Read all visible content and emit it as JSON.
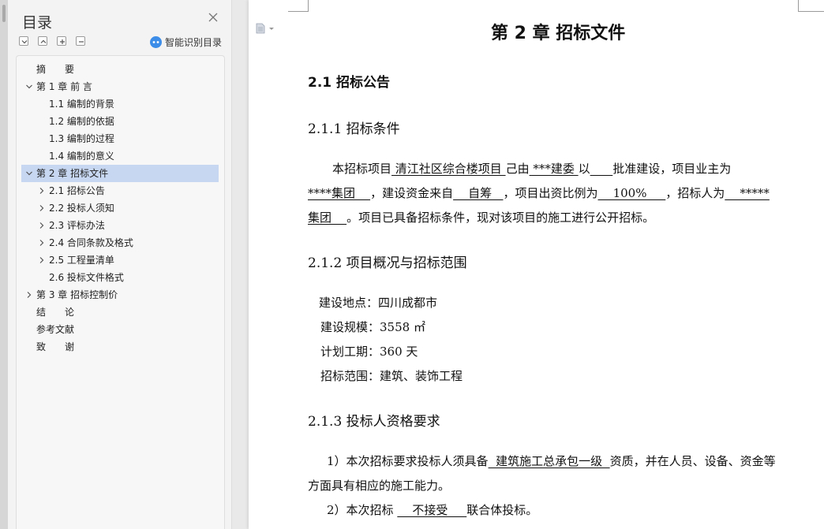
{
  "toc": {
    "title": "目录",
    "smart_label": "智能识别目录",
    "items": [
      {
        "label": "摘　　要",
        "level": 0,
        "chevron": "none"
      },
      {
        "label": "第 1 章  前  言",
        "level": 0,
        "chevron": "down"
      },
      {
        "label": "1.1 编制的背景",
        "level": 1,
        "chevron": "none"
      },
      {
        "label": "1.2 编制的依据",
        "level": 1,
        "chevron": "none"
      },
      {
        "label": "1.3 编制的过程",
        "level": 1,
        "chevron": "none"
      },
      {
        "label": "1.4 编制的意义",
        "level": 1,
        "chevron": "none"
      },
      {
        "label": "第 2 章  招标文件",
        "level": 0,
        "chevron": "down",
        "active": true
      },
      {
        "label": "2.1  招标公告",
        "level": 1,
        "chevron": "right"
      },
      {
        "label": "2.2  投标人须知",
        "level": 1,
        "chevron": "right"
      },
      {
        "label": "2.3  评标办法",
        "level": 1,
        "chevron": "right"
      },
      {
        "label": "2.4  合同条款及格式",
        "level": 1,
        "chevron": "right"
      },
      {
        "label": "2.5 工程量清单",
        "level": 1,
        "chevron": "right"
      },
      {
        "label": "2.6  投标文件格式",
        "level": 1,
        "chevron": "none"
      },
      {
        "label": "第 3 章  招标控制价",
        "level": 0,
        "chevron": "right"
      },
      {
        "label": "结　　论",
        "level": 0,
        "chevron": "none"
      },
      {
        "label": "参考文献",
        "level": 0,
        "chevron": "none"
      },
      {
        "label": "致　　谢",
        "level": 0,
        "chevron": "none"
      }
    ]
  },
  "doc": {
    "chapter_title": "第 2 章  招标文件",
    "h2_1": "2.1  招标公告",
    "h3_1": "2.1.1 招标条件",
    "p1": {
      "a1": "本招标项目",
      "u1": " 清江社区综合楼项目 ",
      "a2": "己由",
      "u2": "   ***建委   ",
      "a3": "以",
      "u3": "      ",
      "a4": "批准建设，项目业主为",
      "u4": "****集团    ",
      "a5": "，建设资金来自",
      "u5": "    自筹   ",
      "a6": "，项目出资比例为",
      "u6": "    100%     ",
      "a7": "，招标人为",
      "u7": "    *****",
      "u8": "集团    ",
      "a8": "。项目已具备招标条件，现对该项目的施工进行公开招标。"
    },
    "h3_2": "2.1.2 项目概况与招标范围",
    "info": [
      "建设地点：四川成都市",
      "建设规模：3558 ㎡",
      "计划工期：360 天",
      "招标范围：建筑、装饰工程"
    ],
    "h3_3": "2.1.3 投标人资格要求",
    "req1": {
      "a1": "1）本次招标要求投标人须具备",
      "u1": "  建筑施工总承包一级  ",
      "a2": "资质，并在人员、设备、资金等",
      "a3": "方面具有相应的施工能力。"
    },
    "req2": {
      "a1": "2）本次招标 ",
      "u1": "    不接受     ",
      "a2": "联合体投标。"
    }
  }
}
